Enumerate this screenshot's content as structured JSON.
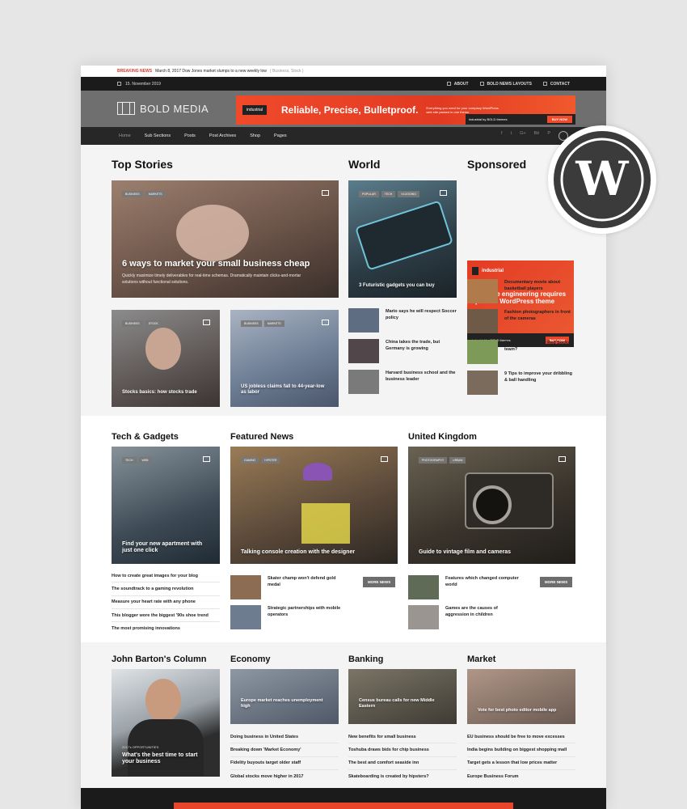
{
  "topline": {
    "breaking_label": "BREAKING NEWS",
    "breaking_text": "March 8, 2017 Dow Jones market slumps to a new weekly low",
    "breaking_tags": "( Business, Stock )"
  },
  "topbar": {
    "date": "15. November 2019",
    "links": [
      "ABOUT",
      "BOLD NEWS LAYOUTS",
      "CONTACT"
    ]
  },
  "header": {
    "logo_text": "BOLD MEDIA",
    "ad": {
      "brand": "industrial",
      "headline": "Reliable, Precise, Bulletproof.",
      "sub": "Everything you need for your company WordPress web site packed in one theme",
      "footer_brand": "industrial by BOLD themes",
      "cta": "BUY NOW"
    }
  },
  "nav": {
    "items": [
      "Home",
      "Sub Sections",
      "Posts",
      "Post Archives",
      "Shop",
      "Pages"
    ],
    "social": [
      "f",
      "t",
      "G+",
      "Bē",
      "P"
    ]
  },
  "top_stories": {
    "heading": "Top Stories",
    "feature": {
      "tags": [
        "BUSINESS",
        "MARKETS"
      ],
      "title": "6 ways to market your small business cheap",
      "desc": "Quickly maximize timely deliverables for real-time schemas. Dramatically maintain clicks-and-mortar solutions without functional solutions."
    },
    "card_a": {
      "tags": [
        "BUSINESS",
        "STOCK"
      ],
      "title": "Stocks basics: how stocks trade"
    },
    "card_b": {
      "tags": [
        "BUSINESS",
        "MARKETS"
      ],
      "title": "US jobless claims fall to 44-year-low as labor"
    }
  },
  "world": {
    "heading": "World",
    "feature": {
      "tags": [
        "POPULAR",
        "TECH",
        "VLOGGING"
      ],
      "title": "3 Futuristic gadgets you can buy"
    },
    "list": [
      "Mario says he will respect Soccer policy",
      "China takes the trade, but Germany is growing",
      "Harvard business school and the business leader"
    ]
  },
  "sponsored": {
    "heading": "Sponsored",
    "ad": {
      "brand": "industrial",
      "headline": "Reliable engineering requires precise WordPress theme",
      "footer_brand": "industrial by BOLD themes",
      "cta": "BUY NOW"
    },
    "list": [
      "Documentary movie about basketball players",
      "Fashion photographers in front of the cameras",
      "Could Ronaldo lead Red Socks team?",
      "9 Tips to improve your dribbling & ball handling"
    ]
  },
  "tech": {
    "heading": "Tech & Gadgets",
    "feature": {
      "tags": [
        "TECH",
        "WEB"
      ],
      "title": "Find your new apartment with just one click"
    },
    "list": [
      "How to create great images for your blog",
      "The soundtrack to a gaming revolution",
      "Measure your heart rate with any phone",
      "This blogger wore the biggest '90s shoe trend",
      "The most promising innovations"
    ]
  },
  "featured": {
    "heading": "Featured News",
    "feature": {
      "tags": [
        "GAMING",
        "HIPSTER"
      ],
      "title": "Talking console creation with the designer"
    },
    "list": [
      "Skater champ won't defend gold medal",
      "Strategic partnerships with mobile operators"
    ],
    "more": "MORE NEWS"
  },
  "uk": {
    "heading": "United Kingdom",
    "feature": {
      "tags": [
        "PHOTOGRAPHY",
        "URBAN"
      ],
      "title": "Guide to vintage film and cameras"
    },
    "list": [
      "Features which changed computer world",
      "Games are the causes of aggression in children"
    ],
    "more": "MORE NEWS"
  },
  "column": {
    "heading": "John Barton's Column",
    "feature": {
      "kicker": "2017's OPPORTUNITIES",
      "title": "What's the best time to start your business"
    }
  },
  "economy": {
    "heading": "Economy",
    "feature": {
      "title": "Europe market reaches unemployment high"
    },
    "list": [
      "Doing business in United States",
      "Breaking down 'Market Economy'",
      "Fidelity buyouts target older staff",
      "Global stocks move higher in 2017"
    ]
  },
  "banking": {
    "heading": "Banking",
    "feature": {
      "title": "Census bureau calls for new Middle Eastern"
    },
    "list": [
      "New benefits for small business",
      "Toshuba draws bids for chip business",
      "The best and comfort seaside inn",
      "Skateboarding is created by hipsters?"
    ]
  },
  "market": {
    "heading": "Market",
    "feature": {
      "title": "Vote for best photo editor mobile app"
    },
    "list": [
      "EU business should be free to move excesses",
      "India begins building on biggest shopping mall",
      "Target gets a lesson that low prices matter",
      "Europe Business Forum"
    ]
  },
  "colors": {
    "accent": "#e8452b",
    "dark": "#1b1b1b",
    "wp_blue": "#3f3f3f"
  }
}
